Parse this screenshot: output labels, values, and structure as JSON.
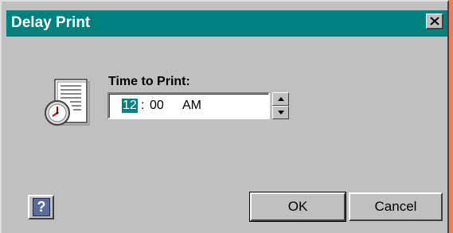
{
  "window": {
    "title": "Delay Print",
    "close_icon": "close-x-icon"
  },
  "form": {
    "icon": "clock-document-icon",
    "label": "Time to Print:",
    "time": {
      "hour": "12",
      "separator": ":",
      "minute": "00",
      "ampm": "AM",
      "selected_segment": "hour"
    },
    "spinner": {
      "up_icon": "arrow-up-icon",
      "down_icon": "arrow-down-icon"
    }
  },
  "buttons": {
    "help_label": "?",
    "ok_label": "OK",
    "cancel_label": "Cancel"
  },
  "colors": {
    "desktop": "#EC7C5D",
    "titlebar": "#00807F",
    "dialog": "#C0C0C0",
    "selection": "#00807F"
  }
}
